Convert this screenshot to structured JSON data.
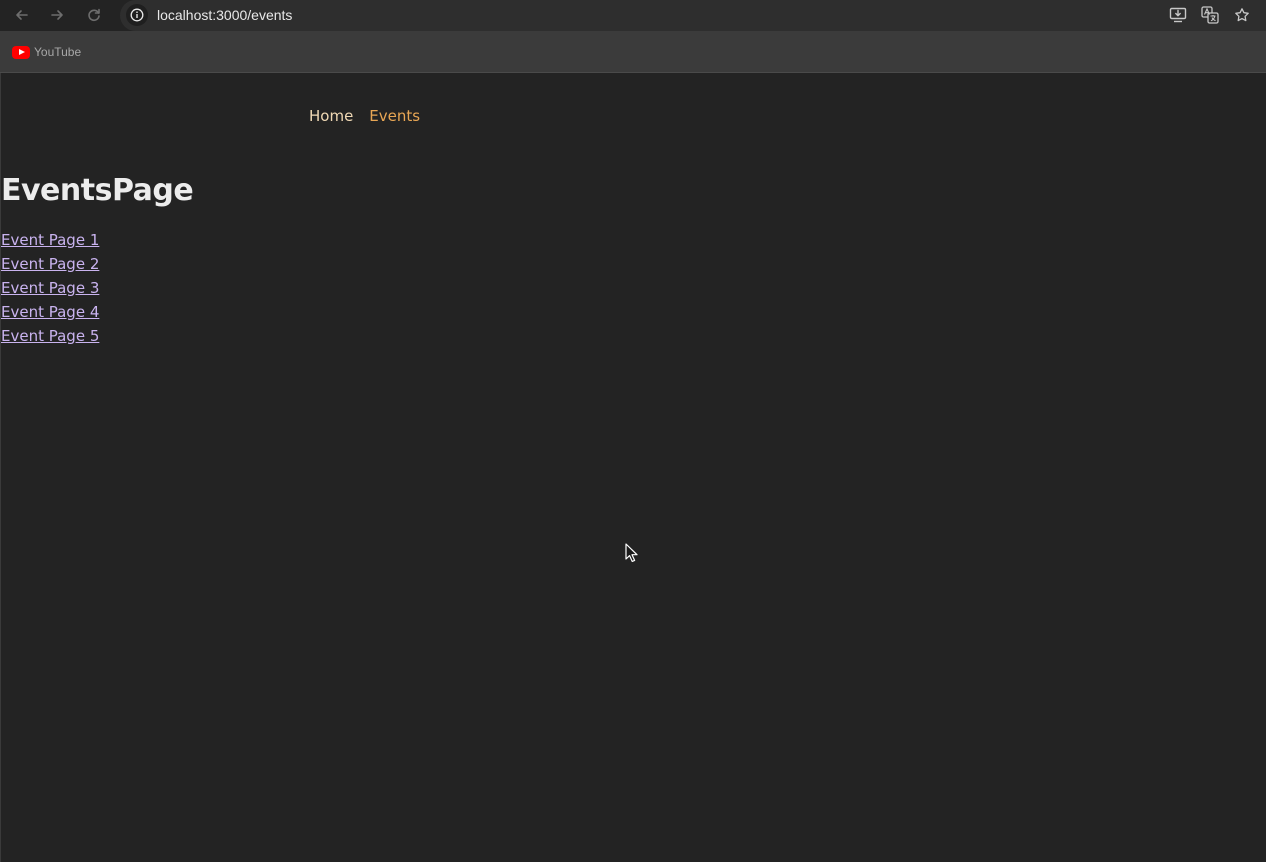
{
  "browser": {
    "url": "localhost:3000/events",
    "icons": {
      "back": "arrow-left-icon",
      "forward": "arrow-right-icon",
      "reload": "reload-icon",
      "site_info": "info-icon",
      "install": "install-app-icon",
      "translate": "translate-icon",
      "bookmark": "star-icon"
    },
    "bookmarks": [
      {
        "label": "YouTube",
        "icon": "youtube-icon"
      }
    ]
  },
  "site": {
    "nav": {
      "home": "Home",
      "events": "Events"
    },
    "title": "EventsPage",
    "events": [
      "Event Page 1",
      "Event Page 2",
      "Event Page 3",
      "Event Page 4",
      "Event Page 5"
    ]
  },
  "colors": {
    "background": "#232323",
    "nav_home": "#f0d9b5",
    "nav_active": "#e8a654",
    "link": "#c9b3ef",
    "title": "#ececec"
  }
}
